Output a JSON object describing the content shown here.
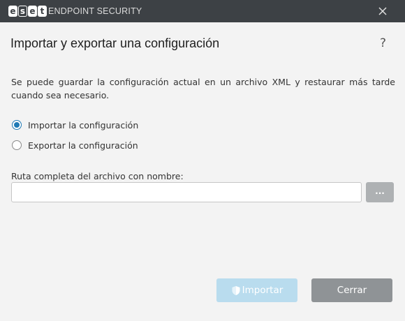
{
  "window": {
    "logo_letters": [
      "e",
      "s",
      "e",
      "t"
    ],
    "product_name": "ENDPOINT SECURITY",
    "close_icon": "close-icon"
  },
  "dialog": {
    "title": "Importar y exportar una configuración",
    "help_icon": "?",
    "description": "Se puede guardar la configuración actual en un archivo XML y restaurar más tarde cuando sea necesario."
  },
  "options": [
    {
      "label": "Importar la configuración",
      "checked": true
    },
    {
      "label": "Exportar la configuración",
      "checked": false
    }
  ],
  "file": {
    "label": "Ruta completa del archivo con nombre:",
    "value": "",
    "placeholder": "",
    "browse_label": "..."
  },
  "buttons": {
    "import_label": "Importar",
    "close_label": "Cerrar"
  },
  "colors": {
    "titlebar": "#3d4145",
    "accent": "#1f7ab5",
    "import_button": "#b9dcee",
    "close_button": "#8f9396"
  }
}
